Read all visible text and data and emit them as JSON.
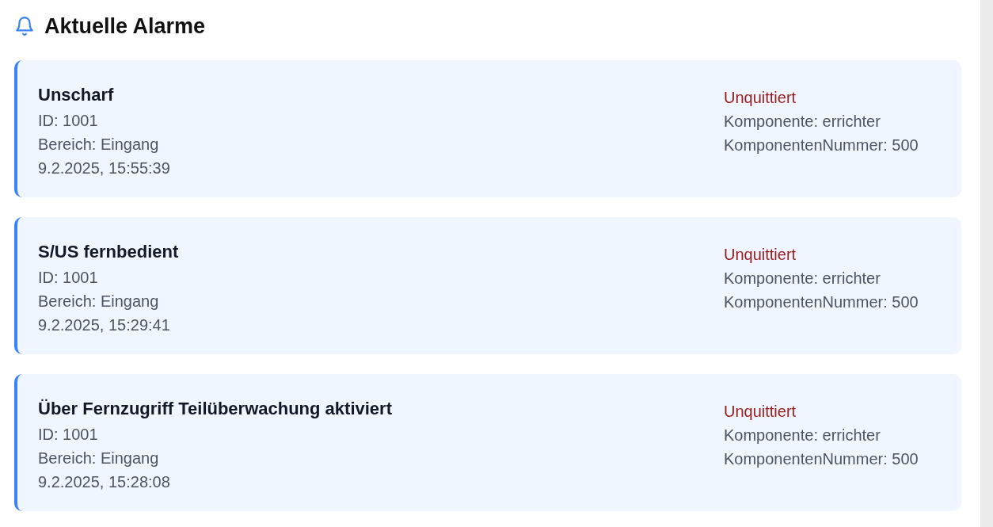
{
  "header": {
    "title": "Aktuelle Alarme"
  },
  "alarms": [
    {
      "title": "Unscharf",
      "id": "ID: 1001",
      "area": "Bereich: Eingang",
      "time": "9.2.2025, 15:55:39",
      "status": "Unquittiert",
      "component": "Komponente: errichter",
      "component_number": "KomponentenNummer: 500"
    },
    {
      "title": "S/US fernbedient",
      "id": "ID: 1001",
      "area": "Bereich: Eingang",
      "time": "9.2.2025, 15:29:41",
      "status": "Unquittiert",
      "component": "Komponente: errichter",
      "component_number": "KomponentenNummer: 500"
    },
    {
      "title": "Über Fernzugriff Teilüberwachung aktiviert",
      "id": "ID: 1001",
      "area": "Bereich: Eingang",
      "time": "9.2.2025, 15:28:08",
      "status": "Unquittiert",
      "component": "Komponente: errichter",
      "component_number": "KomponentenNummer: 500"
    }
  ]
}
